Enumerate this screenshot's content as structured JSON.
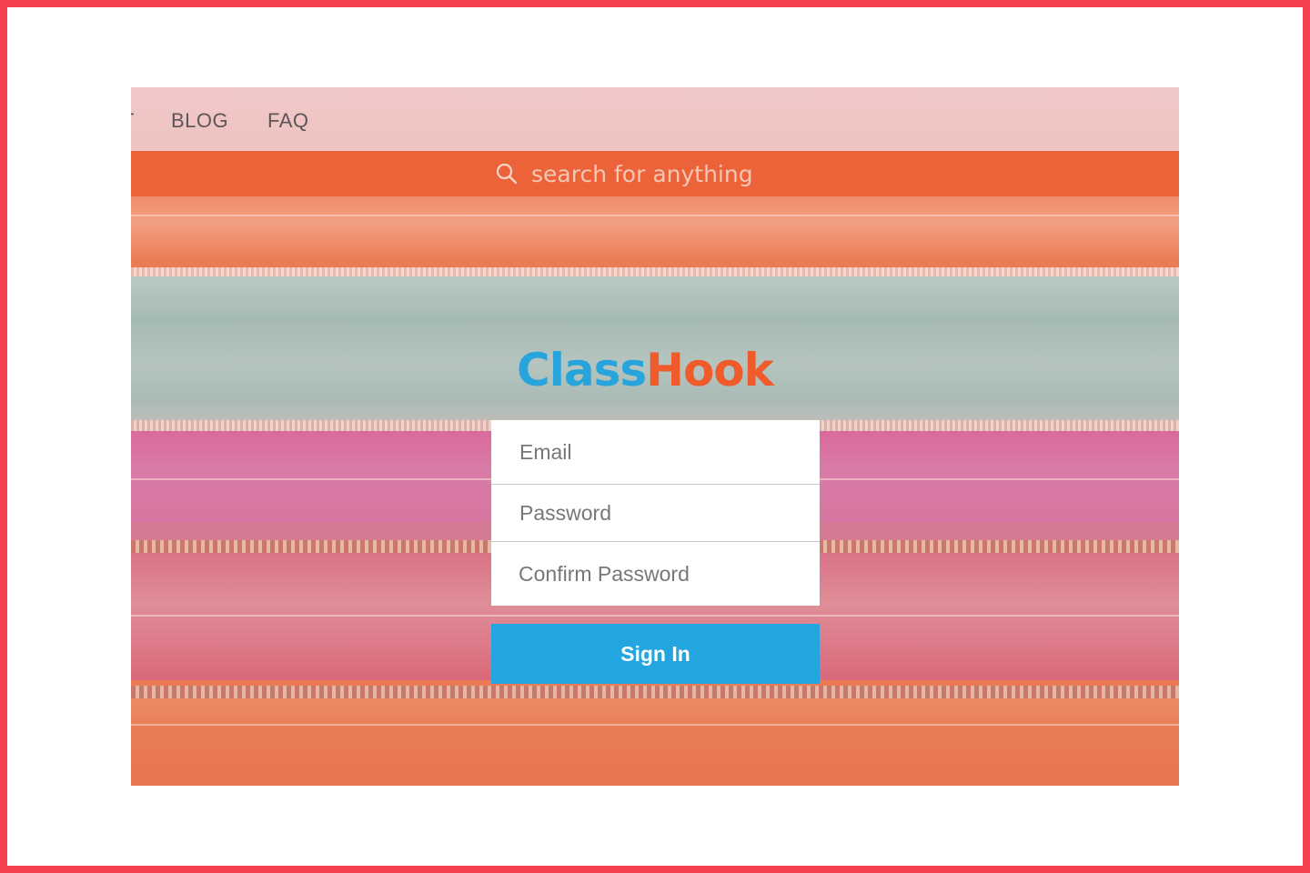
{
  "nav": {
    "partial_label": "T",
    "blog_label": "BLOG",
    "faq_label": "FAQ"
  },
  "search": {
    "icon": "search-icon",
    "placeholder": "search for anything"
  },
  "logo": {
    "part1": "Class",
    "part2": "Hook",
    "colors": {
      "class": "#28a4dd",
      "hook": "#ef5b2b"
    }
  },
  "form": {
    "email_placeholder": "Email",
    "password_placeholder": "Password",
    "confirm_placeholder": "Confirm Password",
    "submit_label": "Sign In"
  },
  "colors": {
    "frame": "#f5404f",
    "button": "#23a6df",
    "search_bar": "#ec6038"
  }
}
